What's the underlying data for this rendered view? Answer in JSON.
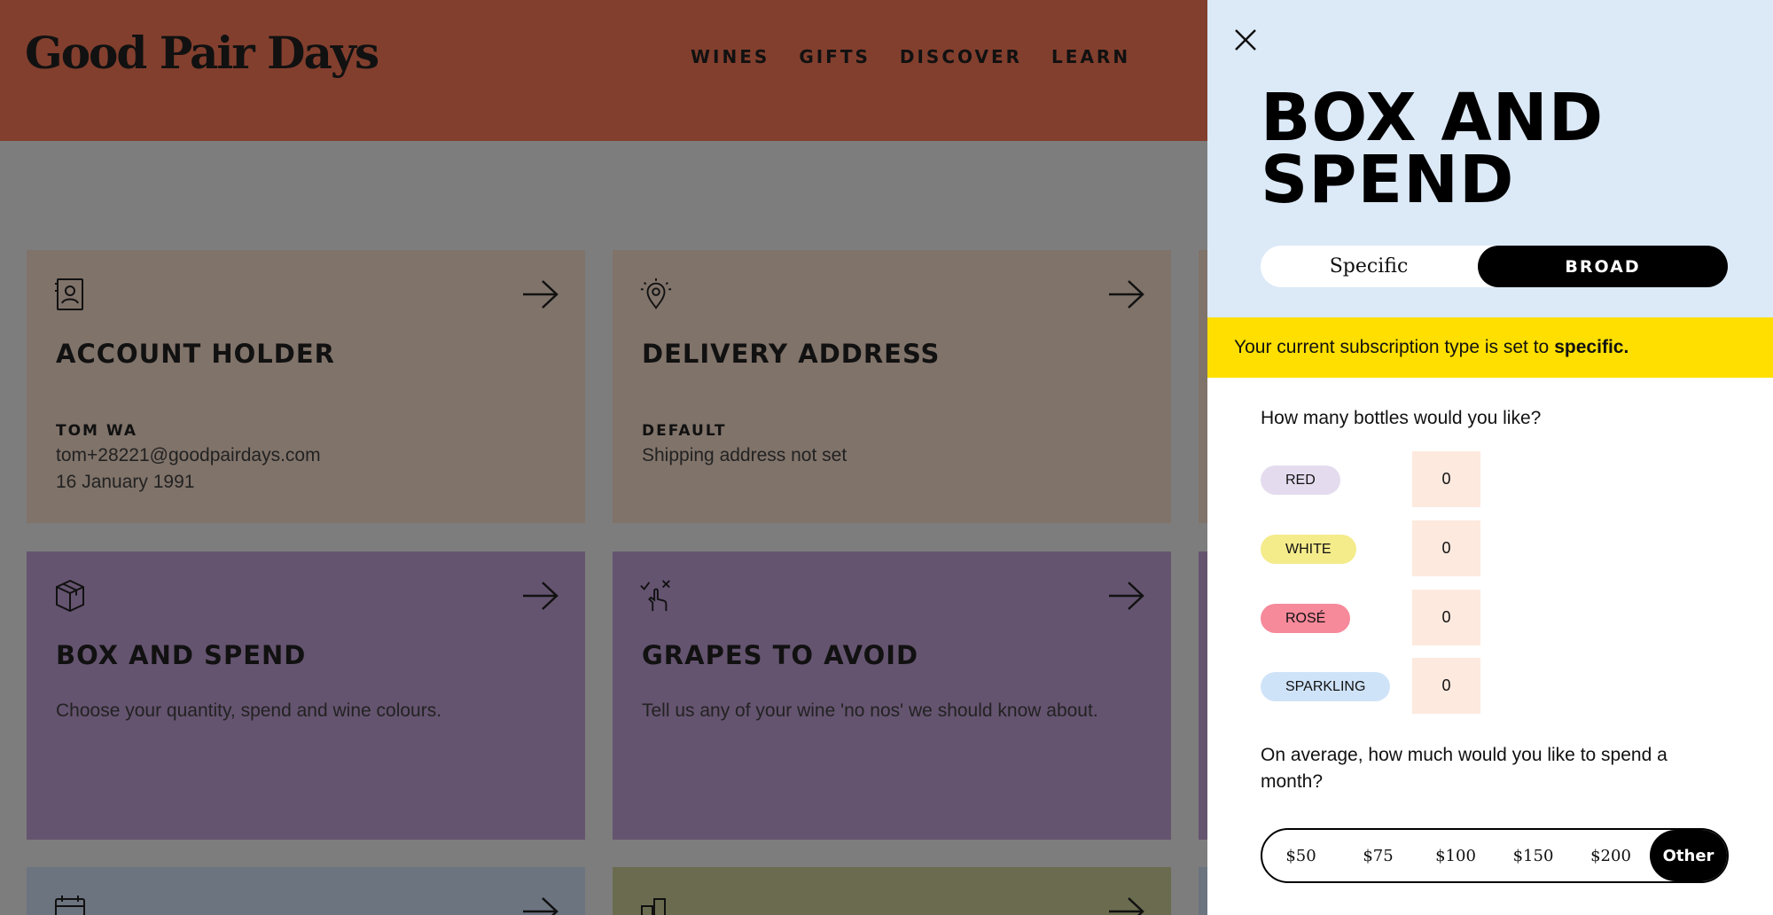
{
  "brand": {
    "logo": "Good Pair Days"
  },
  "nav": {
    "items": [
      "WINES",
      "GIFTS",
      "DISCOVER",
      "LEARN"
    ]
  },
  "cards": [
    {
      "icon": "account-book-icon",
      "title": "ACCOUNT HOLDER",
      "subtitle": "TOM WA",
      "lines": [
        "tom+28221@goodpairdays.com",
        "16 January 1991"
      ]
    },
    {
      "icon": "location-pin-icon",
      "title": "DELIVERY ADDRESS",
      "subtitle": "DEFAULT",
      "lines": [
        "Shipping address not set"
      ]
    },
    {
      "icon": "box-icon",
      "title": "BOX AND SPEND",
      "description": "Choose your quantity, spend and wine colours."
    },
    {
      "icon": "hand-checklist-icon",
      "title": "GRAPES TO AVOID",
      "description": "Tell us any of your wine 'no nos' we should know about."
    },
    {
      "icon": "calendar-icon"
    },
    {
      "icon": "delivery-icon"
    }
  ],
  "panel": {
    "title": "BOX AND SPEND",
    "toggle": {
      "options": [
        "Specific",
        "BROAD"
      ],
      "selected": "BROAD"
    },
    "notice": {
      "text": "Your current subscription type is set to",
      "value": "specific."
    },
    "bottles_question": "How many bottles would you like?",
    "bottles": [
      {
        "label": "RED",
        "value": "0",
        "color": "#e4dcee"
      },
      {
        "label": "WHITE",
        "value": "0",
        "color": "#f4eb8b"
      },
      {
        "label": "ROSÉ",
        "value": "0",
        "color": "#f6899a"
      },
      {
        "label": "SPARKLING",
        "value": "0",
        "color": "#cfe3f8"
      }
    ],
    "spend_question": "On average, how much would you like to spend a month?",
    "spend_options": [
      "$50",
      "$75",
      "$100",
      "$150",
      "$200",
      "Other"
    ],
    "spend_selected": "Other"
  },
  "colors": {
    "header": "#823f2e",
    "panel_top": "#dce9f7",
    "notice": "#ffdf00",
    "qty_bg": "#fde9de"
  }
}
